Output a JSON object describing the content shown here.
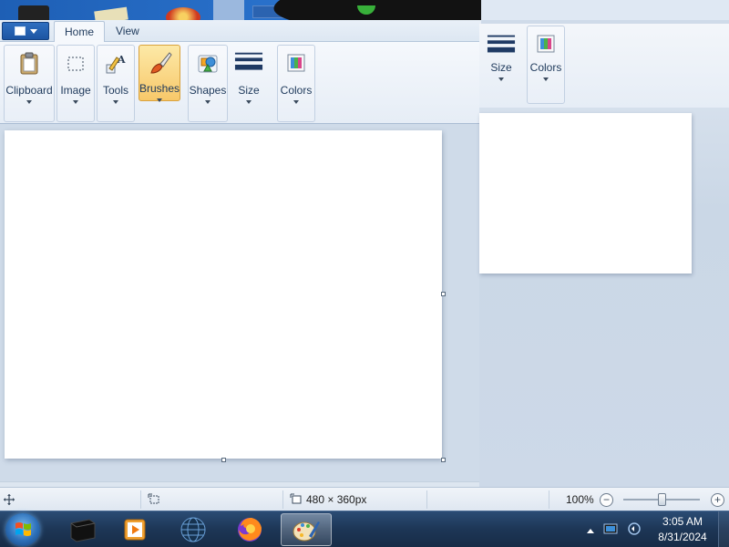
{
  "window": {
    "tabs": [
      {
        "label": "Home"
      },
      {
        "label": "View"
      }
    ]
  },
  "ribbon": {
    "groups": [
      {
        "label": "Clipboard",
        "icon": "clipboard-icon"
      },
      {
        "label": "Image",
        "icon": "select-icon"
      },
      {
        "label": "Tools",
        "icon": "tools-icon"
      },
      {
        "label": "Brushes",
        "icon": "brush-icon"
      },
      {
        "label": "Shapes",
        "icon": "shapes-icon"
      },
      {
        "label": "Size",
        "icon": "size-icon"
      },
      {
        "label": "Colors",
        "icon": "colors-icon"
      }
    ]
  },
  "overlay_window": {
    "groups": [
      {
        "label": "Size",
        "icon": "size-icon"
      },
      {
        "label": "Colors",
        "icon": "colors-icon"
      }
    ]
  },
  "statusbar": {
    "image_size": "480 × 360px",
    "zoom": "100%",
    "zoom_minus": "−",
    "zoom_plus": "+"
  },
  "taskbar": {
    "time": "3:05 AM",
    "date": "8/31/2024",
    "apps": [
      "terminal-icon",
      "media-player-icon",
      "globe-icon",
      "firefox-icon",
      "paint-icon"
    ]
  },
  "colors": {
    "accent": "#1d55a3",
    "active_group": "#f7c86a",
    "taskbar": "#1d3656"
  }
}
